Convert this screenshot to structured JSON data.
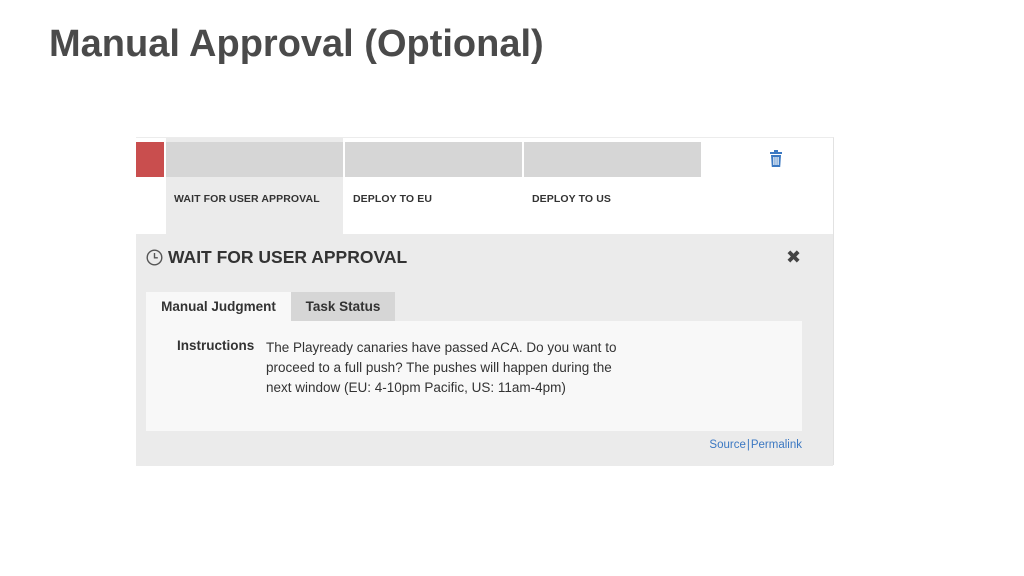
{
  "slide": {
    "title": "Manual Approval (Optional)"
  },
  "pipeline": {
    "status_color": "#c94e4e",
    "stages": [
      {
        "label": "WAIT FOR USER APPROVAL",
        "active": true
      },
      {
        "label": "DEPLOY TO EU",
        "active": false
      },
      {
        "label": "DEPLOY TO US",
        "active": false
      }
    ],
    "delete_icon": "trash-icon"
  },
  "detail": {
    "icon": "clock-icon",
    "title": "WAIT FOR USER APPROVAL",
    "close_icon": "close-icon",
    "tabs": [
      {
        "label": "Manual Judgment",
        "selected": true
      },
      {
        "label": "Task Status",
        "selected": false
      }
    ],
    "instructions_label": "Instructions",
    "instructions_lines": [
      "The Playready canaries have passed ACA. Do you want to",
      "proceed to a full push? The pushes will happen during the",
      "next window (EU: 4-10pm Pacific, US: 11am-4pm)"
    ],
    "links": {
      "source": "Source",
      "separator": "|",
      "permalink": "Permalink"
    },
    "link_color": "#3b78c2"
  }
}
